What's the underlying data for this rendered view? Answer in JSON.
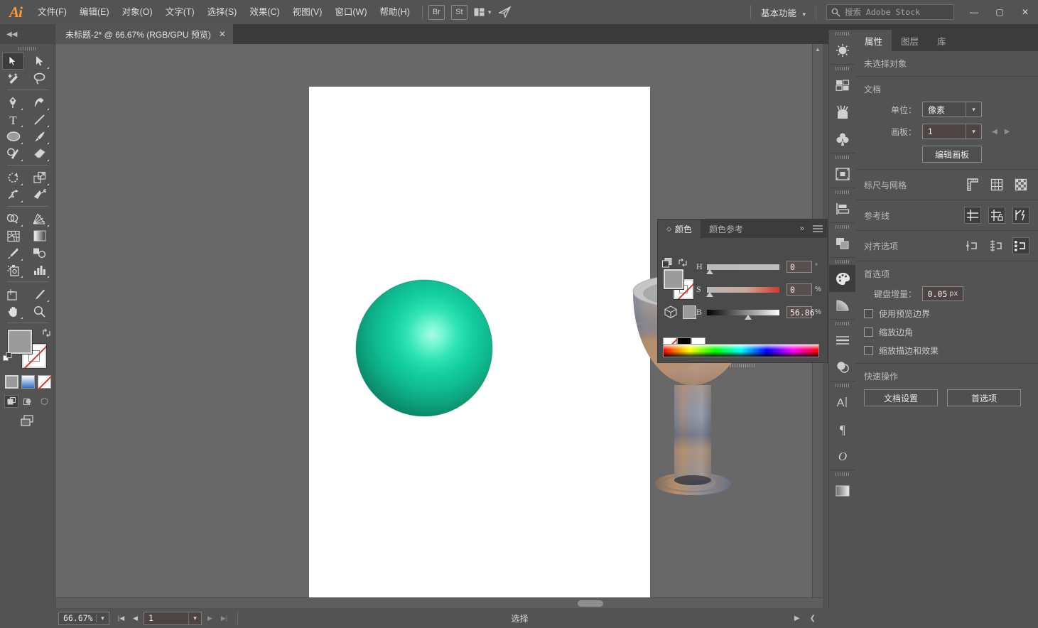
{
  "app": {
    "name": "Adobe Illustrator",
    "logo_text": "Ai"
  },
  "menubar": {
    "items": [
      {
        "label": "文件(F)",
        "name": "menu-file"
      },
      {
        "label": "编辑(E)",
        "name": "menu-edit"
      },
      {
        "label": "对象(O)",
        "name": "menu-object"
      },
      {
        "label": "文字(T)",
        "name": "menu-type"
      },
      {
        "label": "选择(S)",
        "name": "menu-select"
      },
      {
        "label": "效果(C)",
        "name": "menu-effect"
      },
      {
        "label": "视图(V)",
        "name": "menu-view"
      },
      {
        "label": "窗口(W)",
        "name": "menu-window"
      },
      {
        "label": "帮助(H)",
        "name": "menu-help"
      }
    ],
    "bridge_label": "Br",
    "stock_label": "St",
    "arrange_icon": "arrange-documents-icon",
    "share_icon": "share-icon",
    "workspace": "基本功能",
    "search_placeholder": "搜索 Adobe Stock",
    "window_buttons": {
      "minimize": "—",
      "maximize": "▢",
      "close": "✕"
    }
  },
  "tabbar": {
    "collapse_left_icon": "◀◀",
    "collapse_right_icon": "▶▶",
    "document_tab": {
      "title": "未标题-2* @ 66.67% (RGB/GPU 预览)",
      "close_icon": "✕"
    }
  },
  "toolbar": {
    "tools": [
      {
        "name": "selection-tool",
        "label": "选择工具",
        "selected": true,
        "has_flyout": false
      },
      {
        "name": "direct-selection-tool",
        "label": "直接选择工具",
        "selected": false,
        "has_flyout": true
      },
      {
        "name": "magic-wand-tool",
        "label": "魔棒工具",
        "selected": false,
        "has_flyout": false
      },
      {
        "name": "lasso-tool",
        "label": "套索工具",
        "selected": false,
        "has_flyout": false
      },
      {
        "name": "pen-tool",
        "label": "钢笔工具",
        "selected": false,
        "has_flyout": true
      },
      {
        "name": "curvature-tool",
        "label": "曲率工具",
        "selected": false,
        "has_flyout": true
      },
      {
        "name": "type-tool",
        "label": "文字工具",
        "selected": false,
        "has_flyout": true
      },
      {
        "name": "line-segment-tool",
        "label": "直线段工具",
        "selected": false,
        "has_flyout": true
      },
      {
        "name": "ellipse-tool",
        "label": "椭圆工具",
        "selected": false,
        "has_flyout": true
      },
      {
        "name": "paintbrush-tool",
        "label": "画笔工具",
        "selected": false,
        "has_flyout": true
      },
      {
        "name": "shaper-tool",
        "label": "Shaper 工具",
        "selected": false,
        "has_flyout": true
      },
      {
        "name": "eraser-tool",
        "label": "橡皮擦工具",
        "selected": false,
        "has_flyout": true
      },
      {
        "name": "rotate-tool",
        "label": "旋转工具",
        "selected": false,
        "has_flyout": true
      },
      {
        "name": "scale-tool",
        "label": "比例缩放工具",
        "selected": false,
        "has_flyout": true
      },
      {
        "name": "width-tool",
        "label": "宽度工具",
        "selected": false,
        "has_flyout": true
      },
      {
        "name": "free-transform-tool",
        "label": "自由变换工具",
        "selected": false,
        "has_flyout": false
      },
      {
        "name": "shape-builder-tool",
        "label": "形状生成器工具",
        "selected": false,
        "has_flyout": true
      },
      {
        "name": "perspective-grid-tool",
        "label": "透视网格工具",
        "selected": false,
        "has_flyout": true
      },
      {
        "name": "mesh-tool",
        "label": "网格工具",
        "selected": false,
        "has_flyout": false
      },
      {
        "name": "gradient-tool",
        "label": "渐变工具",
        "selected": false,
        "has_flyout": false
      },
      {
        "name": "eyedropper-tool",
        "label": "吸管工具",
        "selected": false,
        "has_flyout": true
      },
      {
        "name": "blend-tool",
        "label": "混合工具",
        "selected": false,
        "has_flyout": false
      },
      {
        "name": "symbol-sprayer-tool",
        "label": "符号喷枪工具",
        "selected": false,
        "has_flyout": true
      },
      {
        "name": "column-graph-tool",
        "label": "柱形图工具",
        "selected": false,
        "has_flyout": true
      },
      {
        "name": "artboard-tool",
        "label": "画板工具",
        "selected": false,
        "has_flyout": false
      },
      {
        "name": "slice-tool",
        "label": "切片工具",
        "selected": false,
        "has_flyout": true
      },
      {
        "name": "hand-tool",
        "label": "抓手工具",
        "selected": false,
        "has_flyout": true
      },
      {
        "name": "zoom-tool",
        "label": "缩放工具",
        "selected": false,
        "has_flyout": false
      }
    ],
    "fill_color": "#9b9b9b",
    "stroke_color": "#ffffff",
    "swap_icon": "swap-fill-stroke-icon",
    "default_icon": "default-fill-stroke-icon",
    "modes": [
      "color-swatch",
      "gradient-swatch",
      "none-swatch"
    ],
    "draw_modes": [
      "draw-normal",
      "draw-behind",
      "draw-inside"
    ],
    "screen_mode_icon": "change-screen-mode-icon"
  },
  "canvas": {
    "artboard_background": "#ffffff",
    "background": "#686868",
    "artwork": [
      {
        "name": "green-sphere",
        "type": "3d-revolve-sphere",
        "colors": [
          "#6ff7d2",
          "#0fcf9e",
          "#0e9e77",
          "#0b7d5e"
        ]
      },
      {
        "name": "goblet-3d",
        "type": "3d-revolve-goblet",
        "colors": [
          "#c2c2c2",
          "#8fa0b4",
          "#b98a62",
          "#5f6b7d"
        ]
      }
    ],
    "hscroll_thumb": true
  },
  "color_panel": {
    "tabs": [
      {
        "label": "颜色",
        "active": true,
        "name": "tab-color"
      },
      {
        "label": "颜色参考",
        "active": false,
        "name": "tab-color-guide"
      }
    ],
    "collapse_icon": "»",
    "menu_icon": "panel-menu-icon",
    "sliders": [
      {
        "label": "H",
        "value": "0",
        "unit": "°",
        "pos": 4
      },
      {
        "label": "S",
        "value": "0",
        "unit": "%",
        "pos": 4
      },
      {
        "label": "B",
        "value": "56.86",
        "unit": "%",
        "pos": 57
      }
    ],
    "fill_color": "#9b9b9b",
    "stroke_color": "#ffffff",
    "quick_swatches": [
      "none",
      "black",
      "white"
    ],
    "spectrum": "hue-spectrum-bar"
  },
  "rail": {
    "icons": [
      {
        "name": "gear-properties-icon",
        "glyph": "sun",
        "selected": false
      },
      {
        "name": "swatches-icon",
        "glyph": "swatches",
        "selected": false
      },
      {
        "name": "brushes-icon",
        "glyph": "brushes",
        "selected": false
      },
      {
        "name": "symbols-icon",
        "glyph": "clover",
        "selected": false
      },
      {
        "name": "artboards-icon",
        "glyph": "artboard",
        "selected": false
      },
      {
        "name": "align-icon",
        "glyph": "align",
        "selected": false
      },
      {
        "name": "pathfinder-icon",
        "glyph": "pathfinder",
        "selected": false
      },
      {
        "name": "color-panel-icon",
        "glyph": "palette",
        "selected": true
      },
      {
        "name": "gradient-icon",
        "glyph": "gradient-quarter",
        "selected": false
      },
      {
        "name": "stroke-icon",
        "glyph": "stroke-lines",
        "selected": false
      },
      {
        "name": "transparency-icon",
        "glyph": "transparency",
        "selected": false
      },
      {
        "name": "character-icon",
        "glyph": "A",
        "selected": false
      },
      {
        "name": "paragraph-icon",
        "glyph": "¶",
        "selected": false
      },
      {
        "name": "glyphs-icon",
        "glyph": "O",
        "selected": false
      },
      {
        "name": "gradient-panel-icon",
        "glyph": "gradient-bar",
        "selected": false
      }
    ]
  },
  "properties": {
    "tabs": [
      {
        "label": "属性",
        "active": true,
        "name": "tab-properties"
      },
      {
        "label": "图层",
        "active": false,
        "name": "tab-layers"
      },
      {
        "label": "库",
        "active": false,
        "name": "tab-libraries"
      }
    ],
    "no_selection": "未选择对象",
    "document": {
      "title": "文档",
      "units_label": "单位：",
      "units_value": "像素",
      "artboard_label": "画板：",
      "artboard_value": "1",
      "edit_artboards_button": "编辑画板",
      "prev_icon": "prev-artboard-icon",
      "next_icon": "next-artboard-icon"
    },
    "rulers_grid": {
      "title": "标尺与网格",
      "icons": [
        "show-rulers-icon",
        "show-grid-icon",
        "show-transparency-grid-icon"
      ]
    },
    "guides": {
      "title": "参考线",
      "icons": [
        "show-guides-icon",
        "lock-guides-icon",
        "smart-guides-icon"
      ]
    },
    "align_options": {
      "title": "对齐选项",
      "icons": [
        "align-to-pixel-grid-icon",
        "align-to-anchor-icon",
        "snap-to-point-icon"
      ],
      "active_index": 2
    },
    "preferences": {
      "title": "首选项",
      "keyboard_increment_label": "键盘增量：",
      "keyboard_increment_value": "0.05",
      "keyboard_increment_unit": "px",
      "checkboxes": [
        {
          "label": "使用预览边界",
          "checked": false,
          "name": "use-preview-bounds-checkbox"
        },
        {
          "label": "缩放边角",
          "checked": false,
          "name": "scale-corners-checkbox"
        },
        {
          "label": "缩放描边和效果",
          "checked": false,
          "name": "scale-strokes-effects-checkbox"
        }
      ]
    },
    "quick_actions": {
      "title": "快速操作",
      "buttons": [
        {
          "label": "文档设置",
          "name": "document-setup-button"
        },
        {
          "label": "首选项",
          "name": "preferences-button"
        }
      ]
    }
  },
  "statusbar": {
    "zoom_value": "66.67%",
    "zoom_dropdown_icon": "chevron-down-icon",
    "first_icon": "first-artboard-icon",
    "prev_icon": "prev-artboard-icon",
    "page_value": "1",
    "page_dropdown_icon": "chevron-down-icon",
    "next_icon": "next-artboard-icon",
    "last_icon": "last-artboard-icon",
    "status_text": "选择",
    "play_icon": "status-menu-icon",
    "resize_icon": "resize-grip-icon"
  }
}
